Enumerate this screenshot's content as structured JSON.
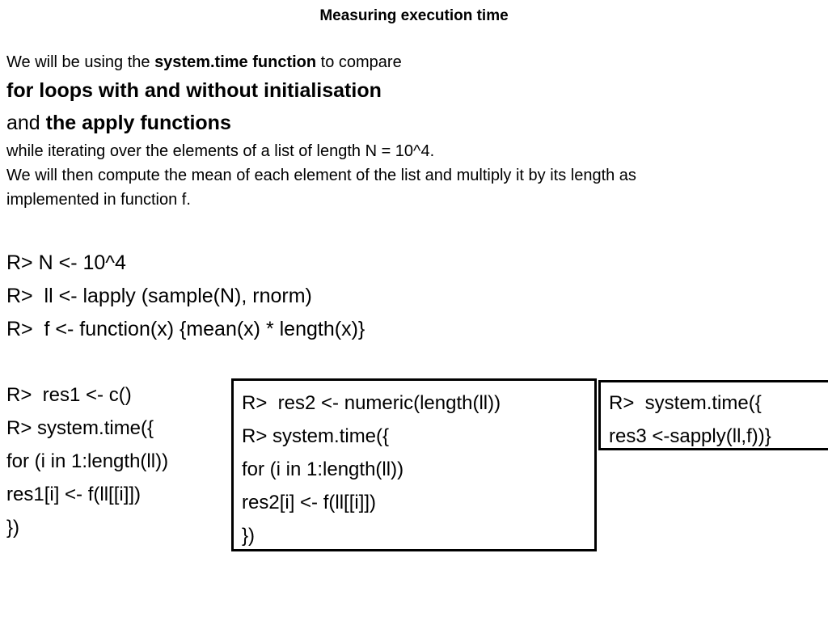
{
  "slide": {
    "title": "Measuring execution time",
    "intro": {
      "line1_pre": "We will be using the ",
      "line1_bold": "system.time function",
      "line1_post": " to compare",
      "line2": "for loops with and without initialisation",
      "line3_pre": "and ",
      "line3_bold": "the apply functions",
      "line4": "while iterating over the elements of a list of length N = 10^4.",
      "line5": "We will then compute the mean of each element of the list and multiply it by its length as",
      "line6": "implemented in function f."
    },
    "code_setup": {
      "line1": "R> N <- 10^4",
      "line2": "R>  ll <- lapply (sample(N), rnorm)",
      "line3": "R>  f <- function(x) {mean(x) * length(x)}"
    },
    "code_block_left": {
      "line1": "R>  res1 <- c()",
      "line2": "R> system.time({",
      "line3": "for (i in 1:length(ll))",
      "line4": "res1[i] <- f(ll[[i]])",
      "line5": "})"
    },
    "code_block_middle": {
      "line1": "R>  res2 <- numeric(length(ll))",
      "line2": "R> system.time({",
      "line3": "for (i in 1:length(ll))",
      "line4": "res2[i] <- f(ll[[i]])",
      "line5": "})"
    },
    "code_block_right": {
      "line1": "R>  system.time({",
      "line2": "res3 <-sapply(ll,f))}"
    }
  },
  "colors": {
    "text": "#000000",
    "background": "#ffffff",
    "border": "#000000"
  }
}
